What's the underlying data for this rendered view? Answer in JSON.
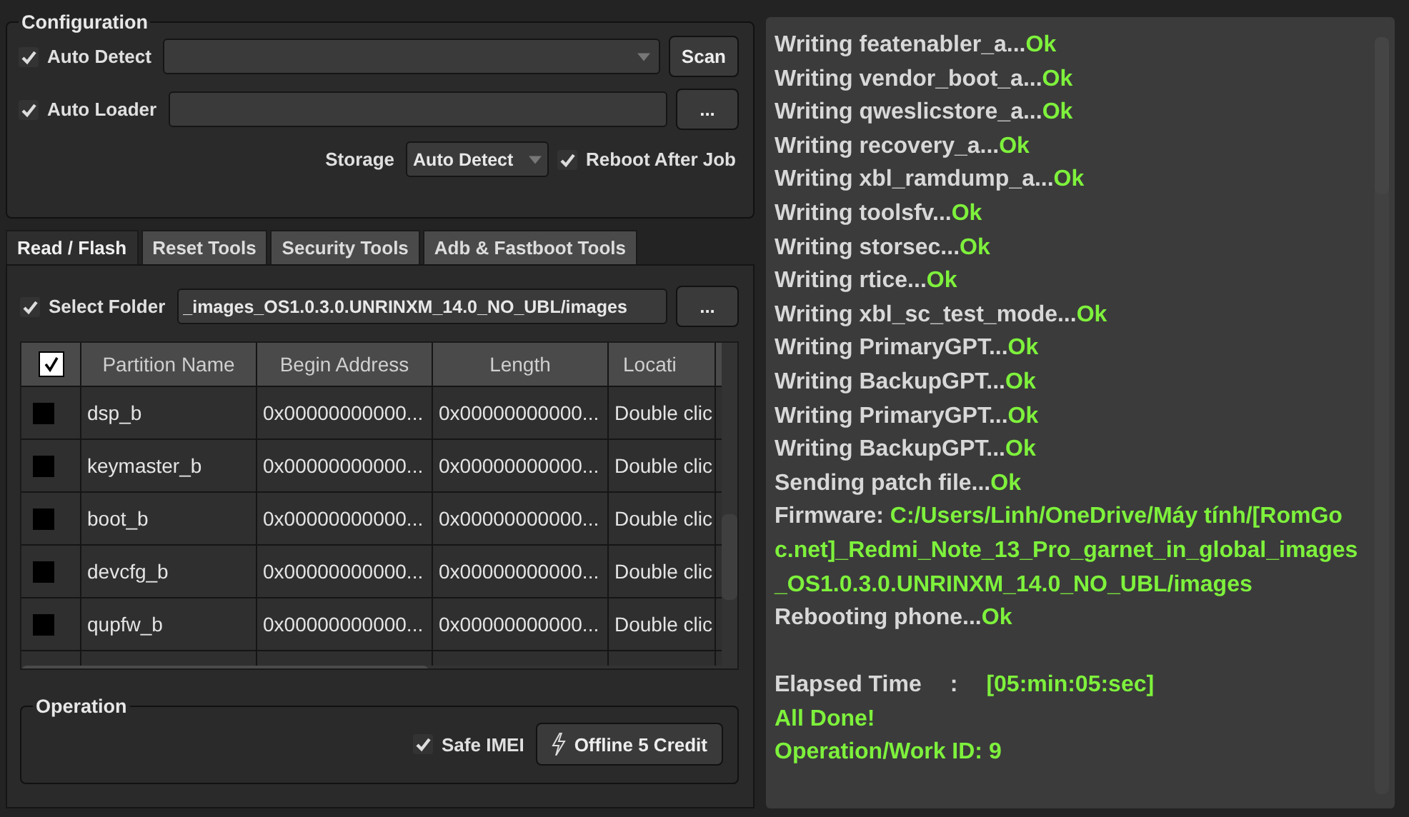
{
  "configuration": {
    "title": "Configuration",
    "auto_detect": {
      "label": "Auto Detect",
      "checked": true
    },
    "scan_button": "Scan",
    "auto_loader": {
      "label": "Auto Loader",
      "checked": true
    },
    "browse_button": "...",
    "storage": {
      "label": "Storage",
      "value": "Auto Detect"
    },
    "reboot_after_job": {
      "label": "Reboot After Job",
      "checked": true
    }
  },
  "tabs": [
    {
      "label": "Read / Flash",
      "selected": true
    },
    {
      "label": "Reset Tools",
      "selected": false
    },
    {
      "label": "Security Tools",
      "selected": false
    },
    {
      "label": "Adb & Fastboot Tools",
      "selected": false
    }
  ],
  "select_folder": {
    "label": "Select Folder",
    "checked": true,
    "value": "_images_OS1.0.3.0.UNRINXM_14.0_NO_UBL/images",
    "browse_button": "..."
  },
  "table": {
    "all_checked": true,
    "columns": [
      "Partition Name",
      "Begin Address",
      "Length",
      "Locati"
    ],
    "rows": [
      {
        "checked": false,
        "cells": [
          "dsp_b",
          "0x00000000000...",
          "0x00000000000...",
          "Double clic"
        ]
      },
      {
        "checked": false,
        "cells": [
          "keymaster_b",
          "0x00000000000...",
          "0x00000000000...",
          "Double clic"
        ]
      },
      {
        "checked": false,
        "cells": [
          "boot_b",
          "0x00000000000...",
          "0x00000000000...",
          "Double clic"
        ]
      },
      {
        "checked": false,
        "cells": [
          "devcfg_b",
          "0x00000000000...",
          "0x00000000000...",
          "Double clic"
        ]
      },
      {
        "checked": false,
        "cells": [
          "qupfw_b",
          "0x00000000000...",
          "0x00000000000...",
          "Double clic"
        ]
      }
    ]
  },
  "operation": {
    "title": "Operation",
    "safe_imei": {
      "label": "Safe IMEI",
      "checked": true
    },
    "button": "Offline 5 Credit"
  },
  "log": [
    {
      "kind": "status",
      "label": "Writing featenabler_a...",
      "value": "Ok"
    },
    {
      "kind": "status",
      "label": "Writing vendor_boot_a...",
      "value": "Ok"
    },
    {
      "kind": "status",
      "label": "Writing qweslicstore_a...",
      "value": "Ok"
    },
    {
      "kind": "status",
      "label": "Writing recovery_a...",
      "value": "Ok"
    },
    {
      "kind": "status",
      "label": "Writing xbl_ramdump_a...",
      "value": "Ok"
    },
    {
      "kind": "status",
      "label": "Writing toolsfv...",
      "value": "Ok"
    },
    {
      "kind": "status",
      "label": "Writing storsec...",
      "value": "Ok"
    },
    {
      "kind": "status",
      "label": "Writing rtice...",
      "value": "Ok"
    },
    {
      "kind": "status",
      "label": "Writing xbl_sc_test_mode...",
      "value": "Ok"
    },
    {
      "kind": "status",
      "label": "Writing PrimaryGPT...",
      "value": "Ok"
    },
    {
      "kind": "status",
      "label": "Writing BackupGPT...",
      "value": "Ok"
    },
    {
      "kind": "status",
      "label": "Writing PrimaryGPT...",
      "value": "Ok"
    },
    {
      "kind": "status",
      "label": "Writing BackupGPT...",
      "value": "Ok"
    },
    {
      "kind": "status",
      "label": "Sending patch file...",
      "value": "Ok"
    },
    {
      "kind": "status",
      "label": "Firmware: ",
      "value": "C:/Users/Linh/OneDrive/Máy tính/[RomGoc.net]_Redmi_Note_13_Pro_garnet_in_global_images_OS1.0.3.0.UNRINXM_14.0_NO_UBL/images"
    },
    {
      "kind": "status",
      "label": "Rebooting phone...",
      "value": "Ok"
    },
    {
      "kind": "gap"
    },
    {
      "kind": "timer",
      "label": "Elapsed Time",
      "separator": ":",
      "value": "[05:min:05:sec]"
    },
    {
      "kind": "success",
      "value": "All Done!"
    },
    {
      "kind": "success",
      "value": "Operation/Work ID: 9"
    }
  ]
}
